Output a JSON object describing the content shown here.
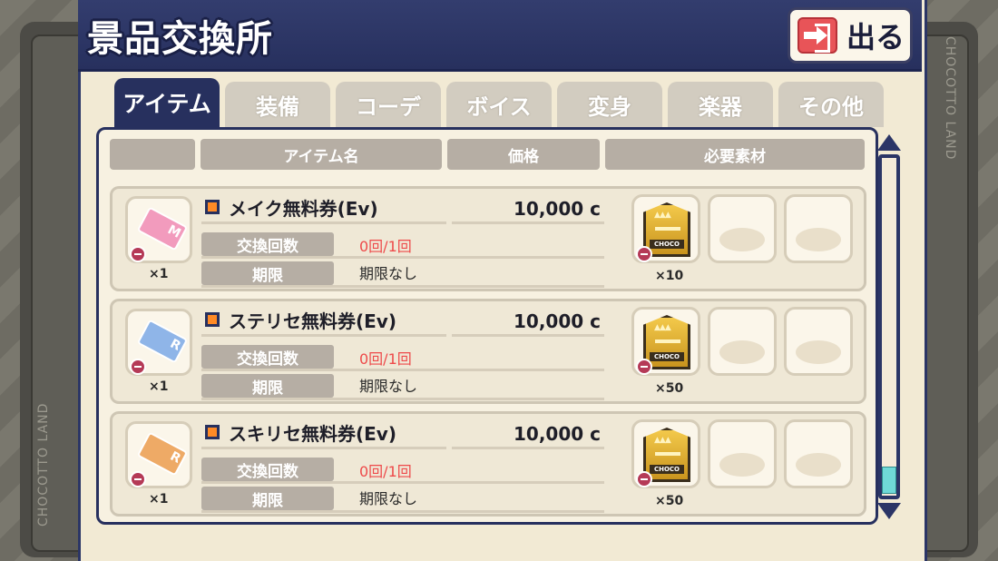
{
  "header": {
    "title": "景品交換所",
    "exit_label": "出る"
  },
  "side_text": "CHOCOTTO LAND",
  "tabs": [
    {
      "label": "アイテム",
      "active": true
    },
    {
      "label": "装備",
      "active": false
    },
    {
      "label": "コーデ",
      "active": false
    },
    {
      "label": "ボイス",
      "active": false
    },
    {
      "label": "変身",
      "active": false
    },
    {
      "label": "楽器",
      "active": false
    },
    {
      "label": "その他",
      "active": false
    }
  ],
  "columns": {
    "blank": "",
    "item_name": "アイテム名",
    "price": "価格",
    "materials": "必要素材"
  },
  "labels": {
    "exchange_count": "交換回数",
    "expiry": "期限"
  },
  "material_code": "CHOCO",
  "items": [
    {
      "name": "メイク無料券(Ev)",
      "price": "10,000 c",
      "exchange_count": "0回/1回",
      "expiry": "期限なし",
      "qty": "×1",
      "ticket_color": "#f29bbd",
      "ticket_letter": "M",
      "material_qty": "×10"
    },
    {
      "name": "ステリセ無料券(Ev)",
      "price": "10,000 c",
      "exchange_count": "0回/1回",
      "expiry": "期限なし",
      "qty": "×1",
      "ticket_color": "#8fb5e8",
      "ticket_letter": "R",
      "material_qty": "×50"
    },
    {
      "name": "スキリセ無料券(Ev)",
      "price": "10,000 c",
      "exchange_count": "0回/1回",
      "expiry": "期限なし",
      "qty": "×1",
      "ticket_color": "#eeaa66",
      "ticket_letter": "R",
      "material_qty": "×50"
    }
  ]
}
